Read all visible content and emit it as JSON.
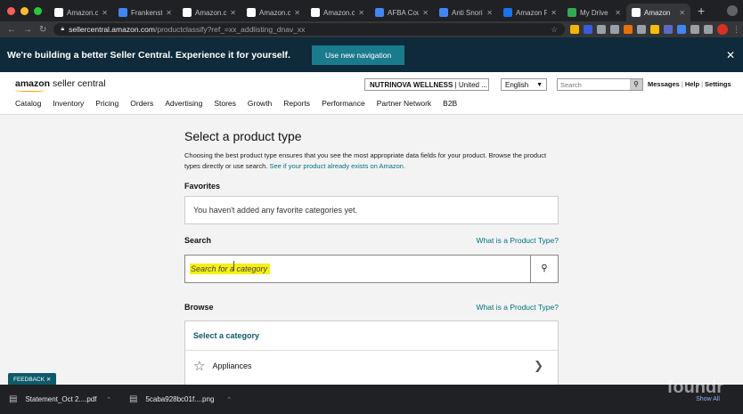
{
  "browser": {
    "tabs": [
      {
        "label": "Amazon.c",
        "icon": "amazon-icon",
        "color": "#ffffff"
      },
      {
        "label": "Frankensta",
        "icon": "frankenstein-icon",
        "color": "#4285f4"
      },
      {
        "label": "Amazon.c",
        "icon": "amazon-icon",
        "color": "#ffffff"
      },
      {
        "label": "Amazon.c",
        "icon": "amazon-icon",
        "color": "#ffffff"
      },
      {
        "label": "Amazon.c",
        "icon": "amazon-icon",
        "color": "#ffffff"
      },
      {
        "label": "AFBA Cou",
        "icon": "doc-icon",
        "color": "#4285f4"
      },
      {
        "label": "Anti Snori",
        "icon": "doc-icon",
        "color": "#4285f4"
      },
      {
        "label": "Amazon F",
        "icon": "chart-icon",
        "color": "#1a73e8"
      },
      {
        "label": "My Drive",
        "icon": "drive-icon",
        "color": "#34a853"
      },
      {
        "label": "Amazon",
        "icon": "amazon-icon",
        "color": "#ffffff",
        "active": true
      }
    ],
    "new_tab": "+",
    "url_host": "sellercentral.amazon.com",
    "url_path": "/productclassify?ref_=xx_addlisting_dnav_xx"
  },
  "banner": {
    "text": "We're building a better Seller Central. Experience it for yourself.",
    "button": "Use new navigation",
    "close": "✕"
  },
  "header": {
    "logo_bold": "amazon",
    "logo_rest": " seller central",
    "merchant_name": "NUTRINOVA WELLNESS",
    "merchant_region": " | United ...",
    "language": "English",
    "search_placeholder": "Search",
    "links": [
      "Messages",
      "Help",
      "Settings"
    ],
    "nav": [
      "Catalog",
      "Inventory",
      "Pricing",
      "Orders",
      "Advertising",
      "Stores",
      "Growth",
      "Reports",
      "Performance",
      "Partner Network",
      "B2B"
    ]
  },
  "page": {
    "title": "Select a product type",
    "description": "Choosing the best product type ensures that you see the most appropriate data fields for your product. Browse the product types directly or use search.",
    "description_link": "See if your product already exists on Amazon.",
    "favorites_title": "Favorites",
    "favorites_empty": "You haven't added any favorite categories yet.",
    "search_title": "Search",
    "search_help": "What is a Product Type?",
    "search_placeholder": "Search for a category",
    "browse_title": "Browse",
    "browse_help": "What is a Product Type?",
    "browse_header": "Select a category",
    "categories": [
      "Appliances"
    ]
  },
  "feedback": "FEEDBACK ✕",
  "downloads": [
    {
      "name": "Statement_Oct 2....pdf"
    },
    {
      "name": "5caba928bc01f....png"
    }
  ],
  "show_all": "Show All",
  "watermark": "foundr"
}
